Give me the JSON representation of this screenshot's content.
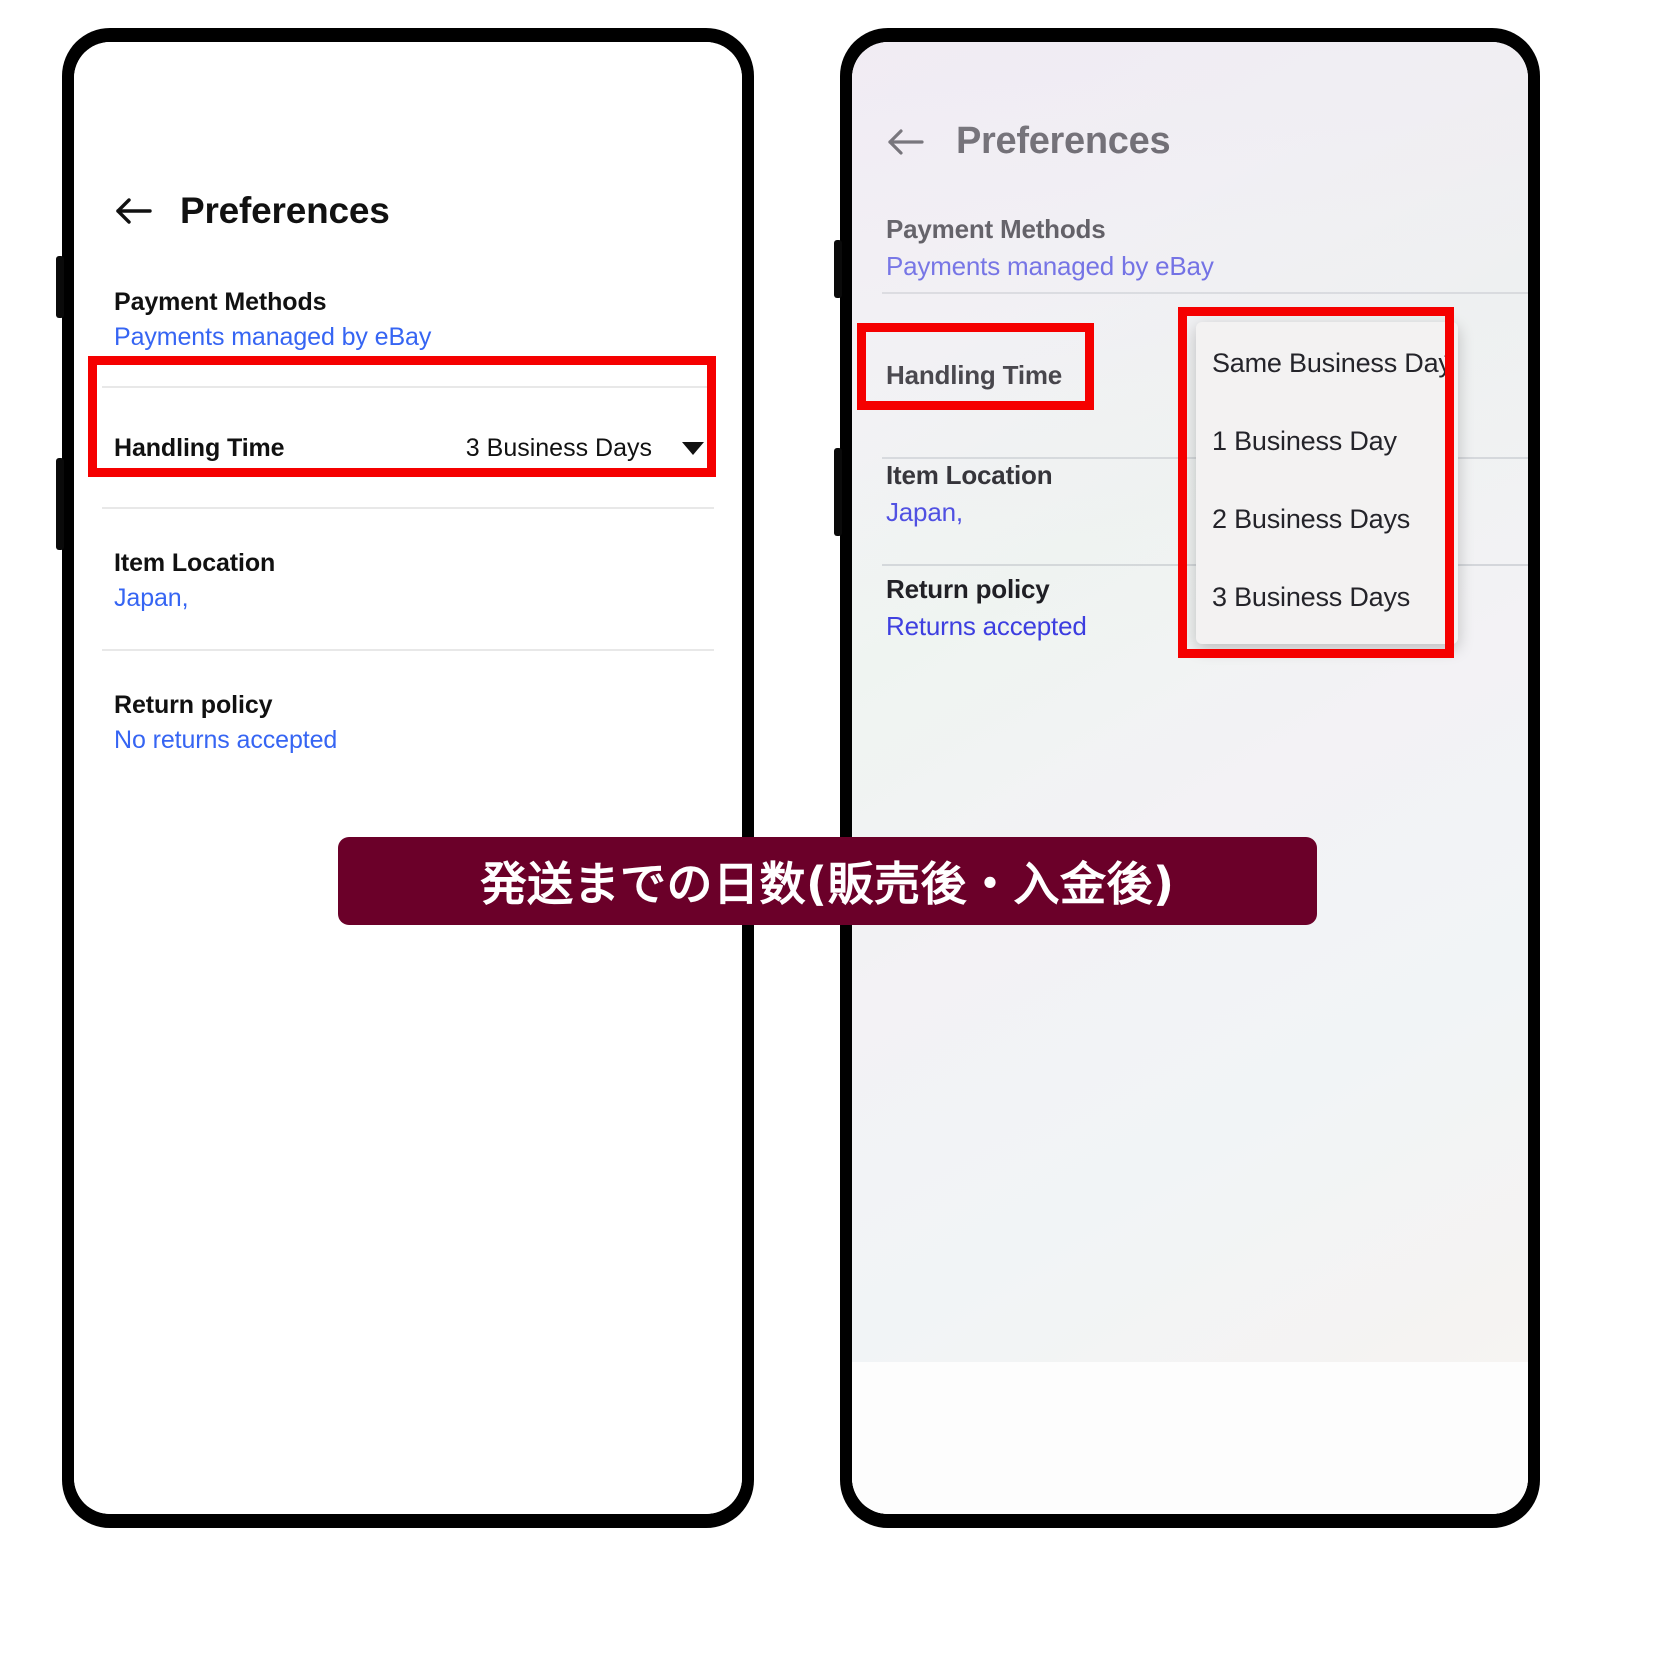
{
  "banner": {
    "text": "発送までの日数(販売後・入金後)",
    "bg_color": "#6b0029",
    "text_color": "#ffffff"
  },
  "annotation": {
    "color": "#f50000"
  },
  "left_phone": {
    "screen": {
      "header": {
        "back_icon": "back-arrow-icon",
        "title": "Preferences"
      },
      "rows": [
        {
          "label": "Payment Methods",
          "value": "Payments managed by eBay",
          "value_color": "#3665f3"
        },
        {
          "label": "Handling Time",
          "value": "3 Business Days",
          "value_color": "#111111",
          "has_dropdown_caret": true
        },
        {
          "label": "Item Location",
          "value": "Japan,",
          "value_color": "#3665f3"
        },
        {
          "label": "Return policy",
          "value": "No returns accepted",
          "value_color": "#3665f3"
        }
      ]
    }
  },
  "right_phone": {
    "screen": {
      "header": {
        "back_icon": "back-arrow-icon",
        "title": "Preferences"
      },
      "rows": [
        {
          "label": "Payment Methods",
          "value": "Payments managed by eBay",
          "value_color": "#3b3ce0"
        },
        {
          "label": "Handling Time",
          "value": "",
          "value_color": "#3b3ce0"
        },
        {
          "label": "Item Location",
          "value": "Japan,",
          "value_color": "#3b3ce0"
        },
        {
          "label": "Return policy",
          "value": "Returns accepted",
          "value_color": "#3b3ce0"
        }
      ],
      "dropdown": {
        "options": [
          {
            "label": "Same Business Day",
            "selected_marker": "⌃"
          },
          {
            "label": "1 Business Day",
            "selected_marker": ""
          },
          {
            "label": "2 Business Days",
            "selected_marker": ""
          },
          {
            "label": "3 Business Days",
            "selected_marker": ""
          }
        ]
      }
    }
  }
}
